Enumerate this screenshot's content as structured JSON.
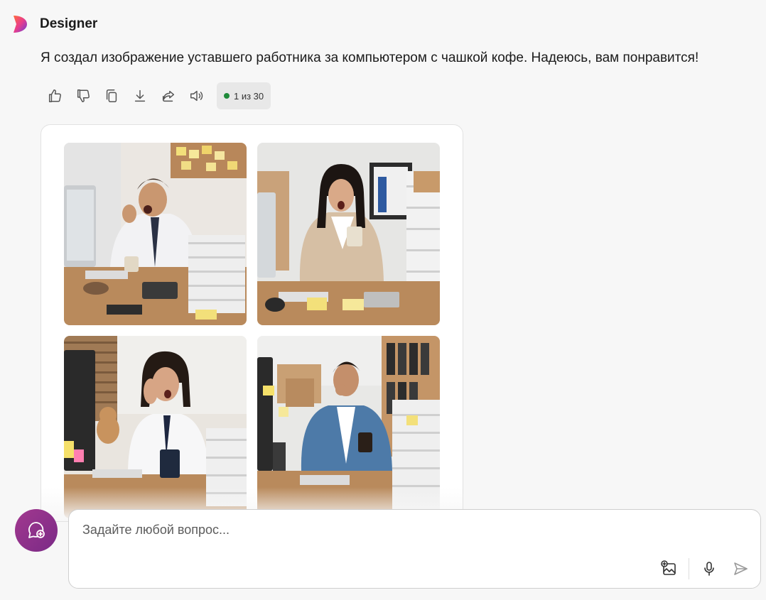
{
  "app": {
    "name": "Designer"
  },
  "message": {
    "text": "Я создал изображение уставшего работника за компьютером с чашкой кофе. Надеюсь, вам понравится!"
  },
  "actions": {
    "icons": [
      "thumbs-up-icon",
      "thumbs-down-icon",
      "copy-icon",
      "download-icon",
      "share-icon",
      "speaker-icon"
    ],
    "counter": "1 из 30"
  },
  "images": [
    {
      "icon": "yawning-man-office-image"
    },
    {
      "icon": "yawning-woman-coffee-image"
    },
    {
      "icon": "tired-woman-desk-image"
    },
    {
      "icon": "yawning-man-denim-image"
    }
  ],
  "composer": {
    "placeholder": "Задайте любой вопрос...",
    "tools": [
      "add-image-icon",
      "microphone-icon",
      "send-icon"
    ]
  },
  "colors": {
    "accent": "#a2388f",
    "status_dot": "#1f8a3a",
    "background": "#f7f7f7"
  }
}
